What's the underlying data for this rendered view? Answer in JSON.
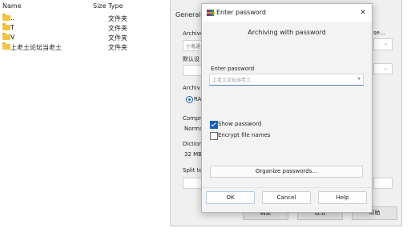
{
  "file_list": {
    "headers": {
      "name": "Name",
      "size": "Size",
      "type": "Type"
    },
    "rows": [
      {
        "name": "..",
        "type": "文件夹"
      },
      {
        "name": "T",
        "type": "文件夹"
      },
      {
        "name": "V",
        "type": "文件夹"
      },
      {
        "name": "上老土论坛当老土",
        "type": "文件夹"
      }
    ]
  },
  "background_dialog": {
    "tab": "General",
    "archive_label": "Archive",
    "archive_value": "小鬼通",
    "browse_label": "se...",
    "default_label": "默认设",
    "archive_format_label": "Archiv",
    "radio_rar": "RA",
    "compression_label": "Compre",
    "compression_value": "Norma",
    "dictionary_label": "Diction",
    "dictionary_value": "32 MB",
    "split_label": "Split to",
    "buttons": {
      "ok": "确定",
      "cancel": "取消",
      "help": "帮助"
    }
  },
  "password_dialog": {
    "title": "Enter password",
    "close_glyph": "✕",
    "subtitle": "Archiving with password",
    "password_label": "Enter password",
    "password_value": "上老土论坛当老土",
    "show_password_label": "Show password",
    "show_password_checked": true,
    "encrypt_names_label": "Encrypt file names",
    "encrypt_names_checked": false,
    "organize_label": "Organize passwords...",
    "buttons": {
      "ok": "OK",
      "cancel": "Cancel",
      "help": "Help"
    },
    "icon": "winrar-books-icon"
  },
  "colors": {
    "accent": "#1c5fb8",
    "folder": "#f3c344"
  }
}
